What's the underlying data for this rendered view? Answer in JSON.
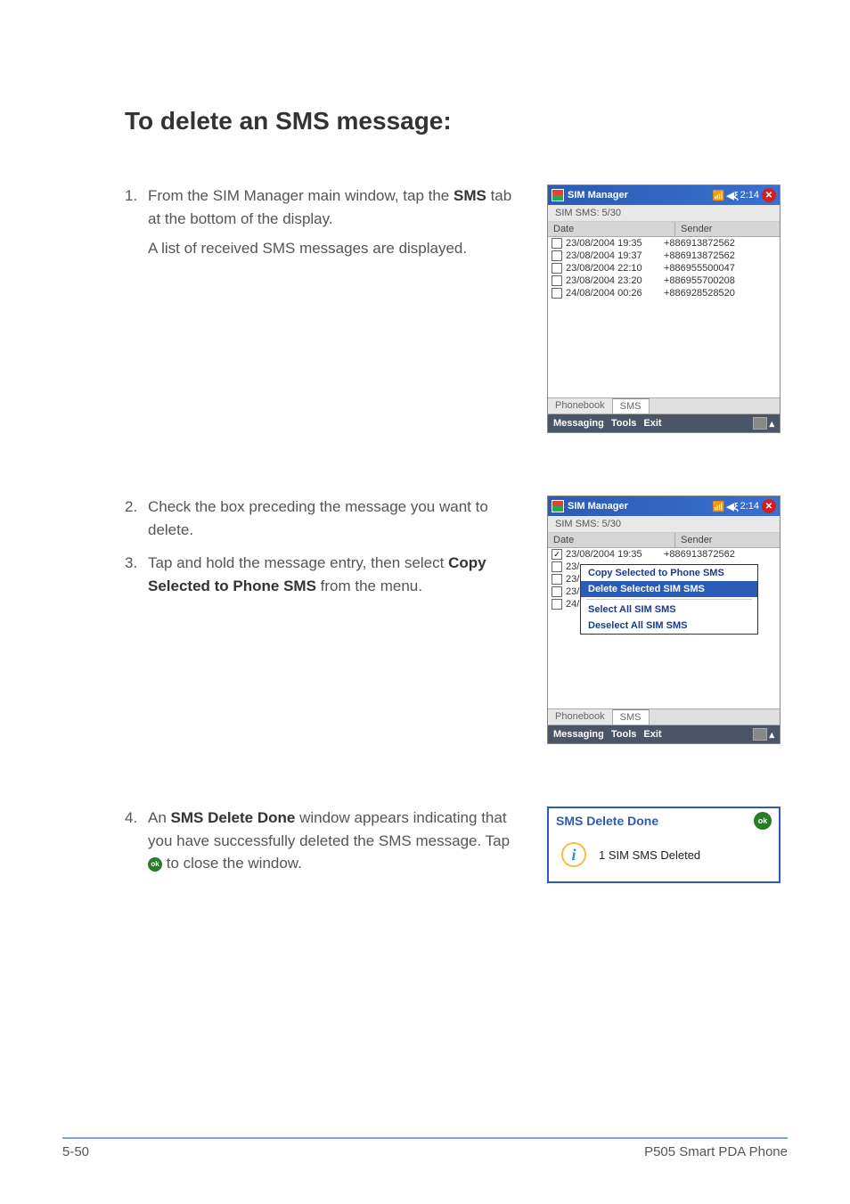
{
  "heading": "To delete an SMS message:",
  "step1": {
    "num": "1.",
    "l1a": "From the SIM Manager main window, tap the ",
    "l1b": "SMS",
    "l1c": " tab at the bottom of the display.",
    "l2": "A list of received SMS messages are displayed."
  },
  "step2": {
    "num": "2.",
    "txt": "Check the box preceding the message you want to delete."
  },
  "step3": {
    "num": "3.",
    "l1a": "Tap and hold the message entry, then select ",
    "l1b": "Copy Selected to Phone SMS",
    "l1c": " from the menu."
  },
  "step4": {
    "num": "4.",
    "l1a": "An ",
    "l1b": "SMS Delete Done",
    "l1c": " window appears  indicating that you have successfully deleted the SMS message. Tap ",
    "l1d": " to close the window."
  },
  "pda": {
    "title": "SIM Manager",
    "clock": "2:14",
    "subhead": "SIM SMS: 5/30",
    "col_date": "Date",
    "col_sender": "Sender",
    "rows": [
      {
        "date": "23/08/2004 19:35",
        "sender": "+886913872562"
      },
      {
        "date": "23/08/2004 19:37",
        "sender": "+886913872562"
      },
      {
        "date": "23/08/2004 22:10",
        "sender": "+886955500047"
      },
      {
        "date": "23/08/2004 23:20",
        "sender": "+886955700208"
      },
      {
        "date": "24/08/2004 00:26",
        "sender": "+886928528520"
      }
    ],
    "tab1": "Phonebook",
    "tab2": "SMS",
    "menu1": "Messaging",
    "menu2": "Tools",
    "menu3": "Exit"
  },
  "ctx": {
    "i1": "Copy Selected to Phone SMS",
    "i2": "Delete Selected SIM SMS",
    "i3": "Select All SIM SMS",
    "i4": "Deselect All SIM SMS"
  },
  "rows2_visible": [
    "23/",
    "23/",
    "23/",
    "24/"
  ],
  "dialog": {
    "title": "SMS Delete Done",
    "ok": "ok",
    "msg": "1 SIM SMS Deleted"
  },
  "footer": {
    "left": "5-50",
    "right": "P505 Smart PDA Phone"
  }
}
